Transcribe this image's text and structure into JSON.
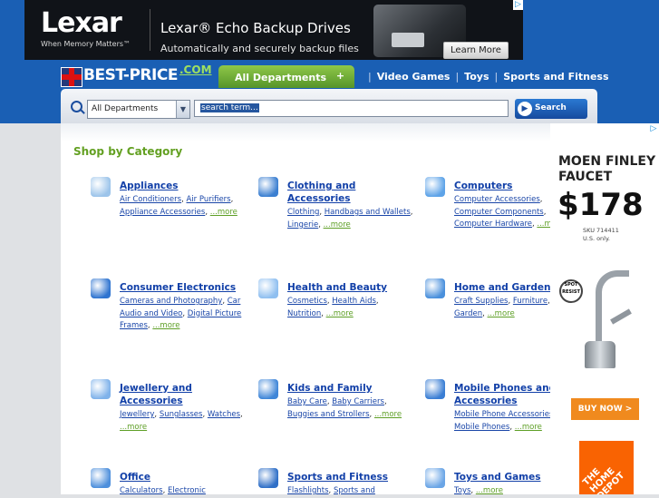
{
  "top_ad": {
    "brand": "Lexar",
    "tagline": "When Memory Matters™",
    "headline": "Lexar® Echo Backup Drives",
    "subline": "Automatically and securely backup files",
    "cta": "Learn More",
    "ad_marker": "▷"
  },
  "header": {
    "logo_text": "BEST-PRICE",
    "logo_suffix": ".COM",
    "departments_tab": "All Departments",
    "departments_plus": "+",
    "nav": [
      "Video Games",
      "Toys",
      "Sports and Fitness"
    ],
    "nav_separator": "|"
  },
  "search": {
    "department_selected": "All Departments",
    "placeholder": "search term...",
    "button_label": "Search"
  },
  "main": {
    "section_title": "Shop by Category",
    "categories": [
      {
        "title": "Appliances",
        "links": [
          "Air Conditioners",
          "Air Purifiers",
          "Appliance Accessories"
        ],
        "more": "...more",
        "color": "#9cc4ea"
      },
      {
        "title": "Clothing and Accessories",
        "links": [
          "Clothing",
          "Handbags and Wallets",
          "Lingerie"
        ],
        "more": "...more",
        "color": "#3b7fd1"
      },
      {
        "title": "Computers",
        "links": [
          "Computer Accessories",
          "Computer Components",
          "Computer Hardware"
        ],
        "more": "...more",
        "color": "#5da3e8"
      },
      {
        "title": "Consumer Electronics",
        "links": [
          "Cameras and Photography",
          "Car Audio and Video",
          "Digital Picture Frames"
        ],
        "more": "...more",
        "color": "#2f74d0"
      },
      {
        "title": "Health and Beauty",
        "links": [
          "Cosmetics",
          "Health Aids",
          "Nutrition"
        ],
        "more": "...more",
        "color": "#8fbff0"
      },
      {
        "title": "Home and Garden",
        "links": [
          "Craft Supplies",
          "Furniture",
          "Garden"
        ],
        "more": "...more",
        "color": "#4a90dc"
      },
      {
        "title": "Jewellery and Accessories",
        "links": [
          "Jewellery",
          "Sunglasses",
          "Watches"
        ],
        "more": "...more",
        "color": "#7fb2ea"
      },
      {
        "title": "Kids and Family",
        "links": [
          "Baby Care",
          "Baby Carriers",
          "Buggies and Strollers"
        ],
        "more": "...more",
        "color": "#3f86d8"
      },
      {
        "title": "Mobile Phones and Accessories",
        "links": [
          "Mobile Phone Accessories",
          "Mobile Phones"
        ],
        "more": "...more",
        "color": "#3a7ed4"
      },
      {
        "title": "Office",
        "links": [
          "Calculators",
          "Electronic"
        ],
        "more": "",
        "color": "#4d8fdc"
      },
      {
        "title": "Sports and Fitness",
        "links": [
          "Flashlights",
          "Sports and"
        ],
        "more": "",
        "color": "#2f6fc7"
      },
      {
        "title": "Toys and Games",
        "links": [
          "Toys"
        ],
        "more": "...more",
        "color": "#6aa5e6"
      }
    ]
  },
  "right_ad": {
    "ad_marker": "▷",
    "title": "MOEN FINLEY FAUCET",
    "price": "$178",
    "sku_line1": "SKU 714411",
    "sku_line2": "U.S. only.",
    "badge": "SPOT RESIST",
    "cta": "BUY NOW >",
    "store": "THE HOME DEPOT"
  }
}
